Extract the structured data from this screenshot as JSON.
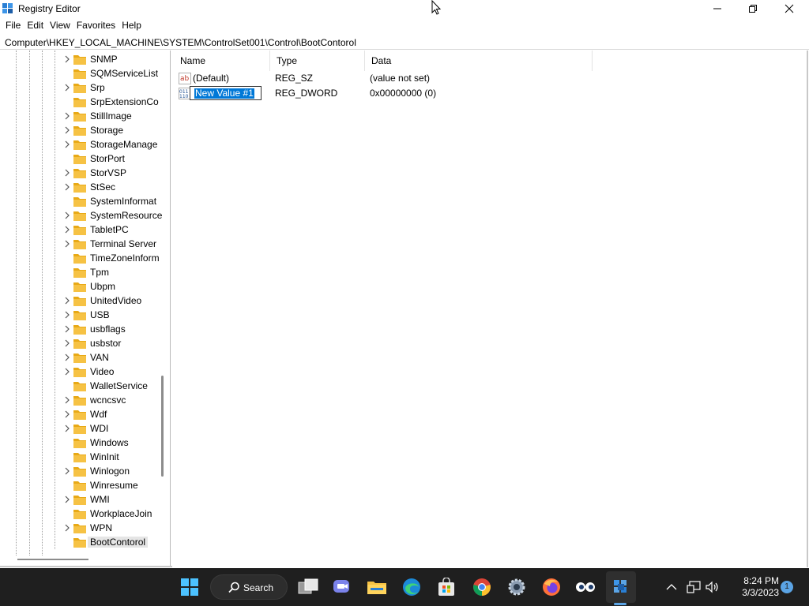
{
  "window": {
    "title": "Registry Editor",
    "controls": [
      "minimize",
      "maximize",
      "close"
    ]
  },
  "menu": [
    "File",
    "Edit",
    "View",
    "Favorites",
    "Help"
  ],
  "address": "Computer\\HKEY_LOCAL_MACHINE\\SYSTEM\\ControlSet001\\Control\\BootContorol",
  "tree": [
    {
      "label": "SNMP",
      "expandable": true
    },
    {
      "label": "SQMServiceList",
      "expandable": false
    },
    {
      "label": "Srp",
      "expandable": true
    },
    {
      "label": "SrpExtensionCo",
      "expandable": false
    },
    {
      "label": "StillImage",
      "expandable": true
    },
    {
      "label": "Storage",
      "expandable": true
    },
    {
      "label": "StorageManage",
      "expandable": true
    },
    {
      "label": "StorPort",
      "expandable": false
    },
    {
      "label": "StorVSP",
      "expandable": true
    },
    {
      "label": "StSec",
      "expandable": true
    },
    {
      "label": "SystemInformat",
      "expandable": false
    },
    {
      "label": "SystemResource",
      "expandable": true
    },
    {
      "label": "TabletPC",
      "expandable": true
    },
    {
      "label": "Terminal Server",
      "expandable": true
    },
    {
      "label": "TimeZoneInform",
      "expandable": false
    },
    {
      "label": "Tpm",
      "expandable": false
    },
    {
      "label": "Ubpm",
      "expandable": false
    },
    {
      "label": "UnitedVideo",
      "expandable": true
    },
    {
      "label": "USB",
      "expandable": true
    },
    {
      "label": "usbflags",
      "expandable": true
    },
    {
      "label": "usbstor",
      "expandable": true
    },
    {
      "label": "VAN",
      "expandable": true
    },
    {
      "label": "Video",
      "expandable": true
    },
    {
      "label": "WalletService",
      "expandable": false
    },
    {
      "label": "wcncsvc",
      "expandable": true
    },
    {
      "label": "Wdf",
      "expandable": true
    },
    {
      "label": "WDI",
      "expandable": true
    },
    {
      "label": "Windows",
      "expandable": false
    },
    {
      "label": "WinInit",
      "expandable": false
    },
    {
      "label": "Winlogon",
      "expandable": true
    },
    {
      "label": "Winresume",
      "expandable": false
    },
    {
      "label": "WMI",
      "expandable": true
    },
    {
      "label": "WorkplaceJoin",
      "expandable": false
    },
    {
      "label": "WPN",
      "expandable": true
    },
    {
      "label": "BootContorol",
      "expandable": false,
      "selected": true
    }
  ],
  "values": {
    "columns": [
      "Name",
      "Type",
      "Data"
    ],
    "rows": [
      {
        "icon": "string-value-icon",
        "name": "(Default)",
        "type": "REG_SZ",
        "data": "(value not set)",
        "editing": false
      },
      {
        "icon": "binary-value-icon",
        "name": "New Value #1",
        "type": "REG_DWORD",
        "data": "0x00000000 (0)",
        "editing": true
      }
    ]
  },
  "taskbar": {
    "search_label": "Search",
    "icons": [
      "start-icon",
      "search-icon",
      "task-view-icon",
      "chat-icon",
      "file-explorer-icon",
      "edge-icon",
      "store-icon",
      "chrome-icon",
      "settings-icon",
      "firefox-icon",
      "eyes-app-icon",
      "registry-editor-icon"
    ],
    "active_app": "registry-editor-icon",
    "time": "8:24 PM",
    "date": "3/3/2023",
    "notification_count": "1"
  },
  "colors": {
    "accent": "#0078d7",
    "folder": "#f6c244",
    "taskbar": "#1f1f1f"
  }
}
